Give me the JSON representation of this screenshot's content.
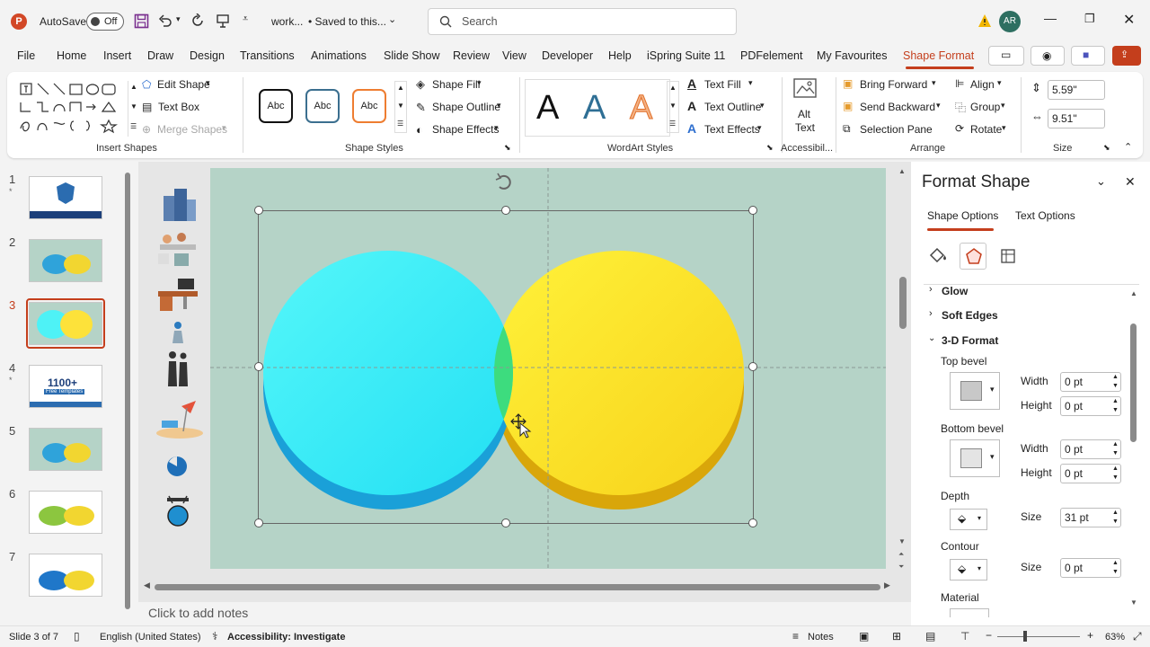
{
  "titlebar": {
    "autosave_label": "AutoSave",
    "autosave_state": "Off",
    "doc_name": "work...",
    "saved_status": "• Saved to this...",
    "search_placeholder": "Search",
    "user_initials": "AR"
  },
  "menu": {
    "items": [
      "File",
      "Home",
      "Insert",
      "Draw",
      "Design",
      "Transitions",
      "Animations",
      "Slide Show",
      "Review",
      "View",
      "Developer",
      "Help",
      "iSpring Suite 11",
      "PDFelement",
      "My Favourites",
      "Shape Format"
    ],
    "active": "Shape Format"
  },
  "ribbon": {
    "insert_shapes": {
      "edit_shape": "Edit Shape",
      "text_box": "Text Box",
      "merge_shapes": "Merge Shapes",
      "label": "Insert Shapes"
    },
    "shape_styles": {
      "style_sample": "Abc",
      "shape_fill": "Shape Fill",
      "shape_outline": "Shape Outline",
      "shape_effects": "Shape Effects",
      "label": "Shape Styles"
    },
    "wordart": {
      "letter": "A",
      "text_fill": "Text Fill",
      "text_outline": "Text Outline",
      "text_effects": "Text Effects",
      "label": "WordArt Styles"
    },
    "accessibility": {
      "alt_text_line1": "Alt",
      "alt_text_line2": "Text",
      "label": "Accessibil..."
    },
    "arrange": {
      "bring_forward": "Bring Forward",
      "send_backward": "Send Backward",
      "selection_pane": "Selection Pane",
      "align": "Align",
      "group": "Group",
      "rotate": "Rotate",
      "label": "Arrange"
    },
    "size": {
      "height": "5.59\"",
      "width": "9.51\"",
      "label": "Size"
    }
  },
  "slides": {
    "numbers": [
      "1",
      "2",
      "3",
      "4",
      "5",
      "6",
      "7"
    ],
    "selected": "3",
    "thumb4_text": "1100+",
    "thumb4_sub": "Free Templates"
  },
  "notes_placeholder": "Click to add notes",
  "format_pane": {
    "title": "Format Shape",
    "tab_shape_options": "Shape Options",
    "tab_text_options": "Text Options",
    "glow": "Glow",
    "soft_edges": "Soft Edges",
    "three_d_format": "3-D Format",
    "top_bevel": "Top bevel",
    "top_width_label": "Width",
    "top_width": "0 pt",
    "top_height_label": "Height",
    "top_height": "0 pt",
    "bottom_bevel": "Bottom bevel",
    "bottom_width_label": "Width",
    "bottom_width": "0 pt",
    "bottom_height_label": "Height",
    "bottom_height": "0 pt",
    "depth": "Depth",
    "depth_size_label": "Size",
    "depth_size": "31 pt",
    "contour": "Contour",
    "contour_size_label": "Size",
    "contour_size": "0 pt",
    "material": "Material"
  },
  "status": {
    "slide_of": "Slide 3 of 7",
    "language": "English (United States)",
    "accessibility": "Accessibility: Investigate",
    "notes": "Notes",
    "zoom": "63%"
  },
  "colors": {
    "accent": "#c43e1c",
    "slide_bg": "#b5d3c7",
    "cyan_circle": "#4ef2f6",
    "yellow_circle": "#fde23a",
    "overlap": "#3ddc7e"
  }
}
